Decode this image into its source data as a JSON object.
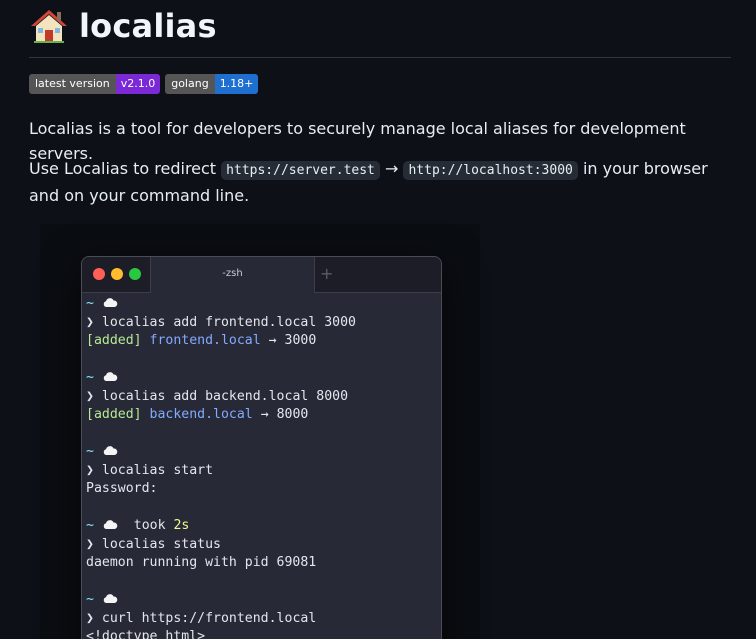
{
  "header": {
    "title": "localias",
    "emoji_icon": "house-icon"
  },
  "badges": [
    {
      "label": "latest version",
      "value": "v2.1.0",
      "color": "#7b29d6"
    },
    {
      "label": "golang",
      "value": "1.18+",
      "color": "#1f6fd1"
    }
  ],
  "intro": {
    "description": "Localias is a tool for developers to securely manage local aliases for development servers.",
    "redirect_prefix": "Use Localias to redirect",
    "from_url": "https://server.test",
    "arrow": "→",
    "to_url": "http://localhost:3000",
    "redirect_suffix": "in your browser and on your command line."
  },
  "terminal": {
    "tab_title": "-zsh",
    "tab_plus": "+",
    "prompt_tilde": "~",
    "prompt_chevron": "❯",
    "lines": [
      {
        "type": "prompt"
      },
      {
        "type": "cmd",
        "text": "localias add frontend.local 3000"
      },
      {
        "type": "added",
        "tag": "[added]",
        "host": "frontend.local",
        "rest": " → 3000"
      },
      {
        "type": "blank"
      },
      {
        "type": "prompt"
      },
      {
        "type": "cmd",
        "text": "localias add backend.local 8000"
      },
      {
        "type": "added",
        "tag": "[added]",
        "host": "backend.local",
        "rest": " → 8000"
      },
      {
        "type": "blank"
      },
      {
        "type": "prompt"
      },
      {
        "type": "cmd",
        "text": "localias start"
      },
      {
        "type": "out",
        "text": "Password:"
      },
      {
        "type": "blank"
      },
      {
        "type": "prompt_took",
        "took": "took",
        "dur": "2s"
      },
      {
        "type": "cmd",
        "text": "localias status"
      },
      {
        "type": "out",
        "text": "daemon running with pid 69081"
      },
      {
        "type": "blank"
      },
      {
        "type": "prompt"
      },
      {
        "type": "cmd",
        "text": "curl https://frontend.local"
      },
      {
        "type": "out",
        "text": "<!doctype html>"
      }
    ]
  },
  "colors": {
    "light_red": "#ff5f57",
    "light_yellow": "#febc2e",
    "light_green": "#28c840"
  }
}
